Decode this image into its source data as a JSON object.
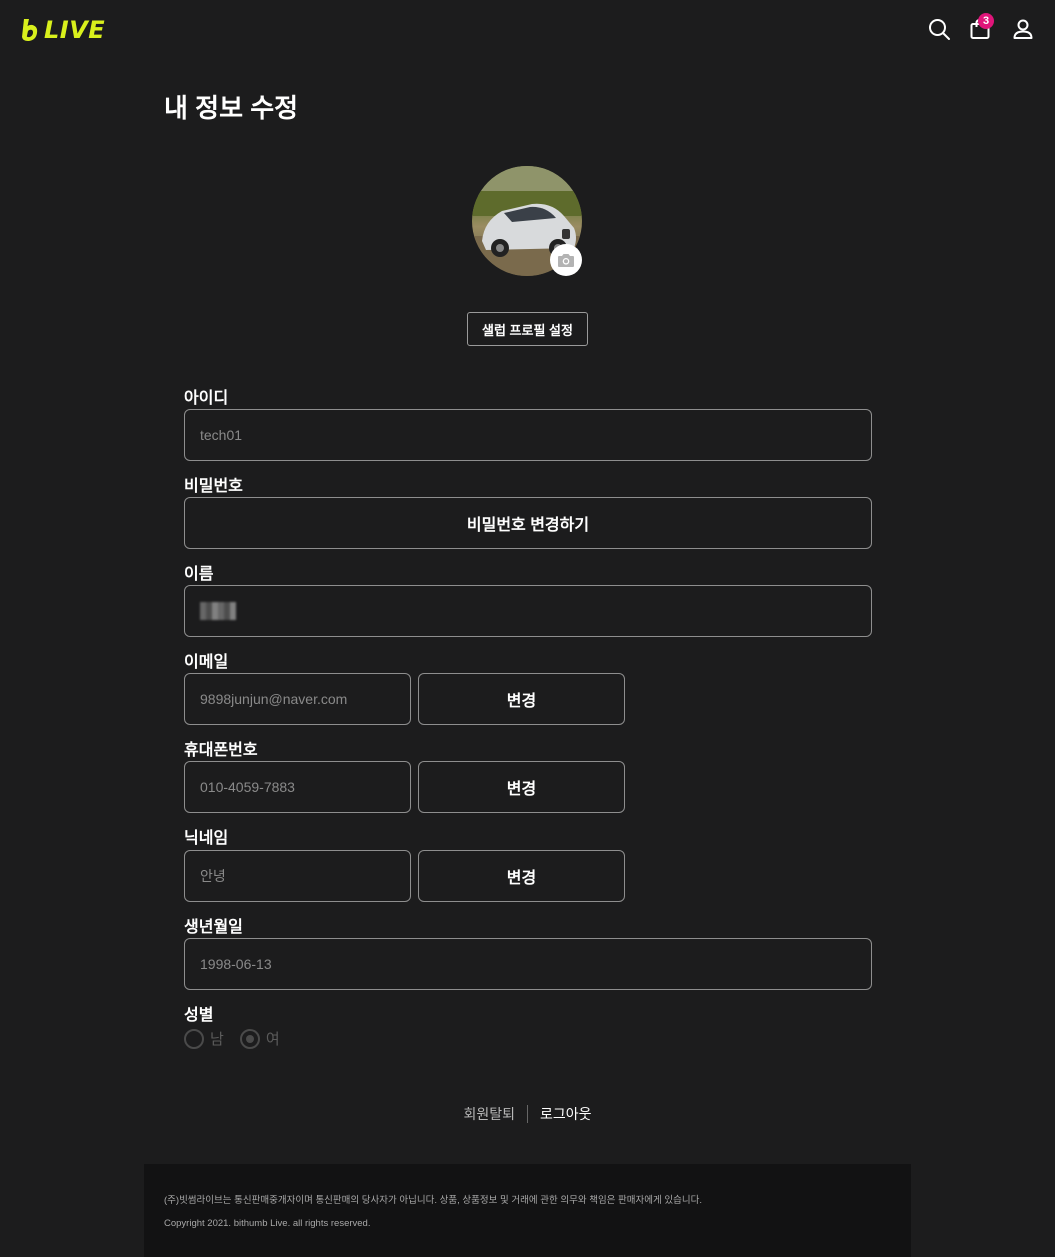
{
  "header": {
    "logo_text": "LIVE",
    "logo_color": "#d9f01c",
    "cart_count": "3",
    "icons": [
      "search-icon",
      "cart-icon",
      "user-icon"
    ]
  },
  "page": {
    "title": "내 정보 수정",
    "celeb_profile_button": "샐럽 프로필 설정"
  },
  "form": {
    "id_label": "아이디",
    "id_value": "tech01",
    "password_label": "비밀번호",
    "password_button": "비밀번호 변경하기",
    "name_label": "이름",
    "email_label": "이메일",
    "email_value": "9898junjun@naver.com",
    "email_change": "변경",
    "phone_label": "휴대폰번호",
    "phone_value": "010-4059-7883",
    "phone_change": "변경",
    "nickname_label": "닉네임",
    "nickname_value": "안녕",
    "nickname_change": "변경",
    "birth_label": "생년월일",
    "birth_value": "1998-06-13",
    "gender_label": "성별",
    "gender_male": "남",
    "gender_female": "여",
    "gender_selected": "여"
  },
  "links": {
    "withdraw": "회원탈퇴",
    "logout": "로그아웃"
  },
  "footer": {
    "notice": "(주)빗썸라이브는 통신판매중개자이며 통신판매의 당사자가 아닙니다. 상품, 상품정보 및 거래에 관한 의무와 책임은 판매자에게 있습니다.",
    "copyright": "Copyright 2021. bithumb Live. all rights reserved."
  }
}
